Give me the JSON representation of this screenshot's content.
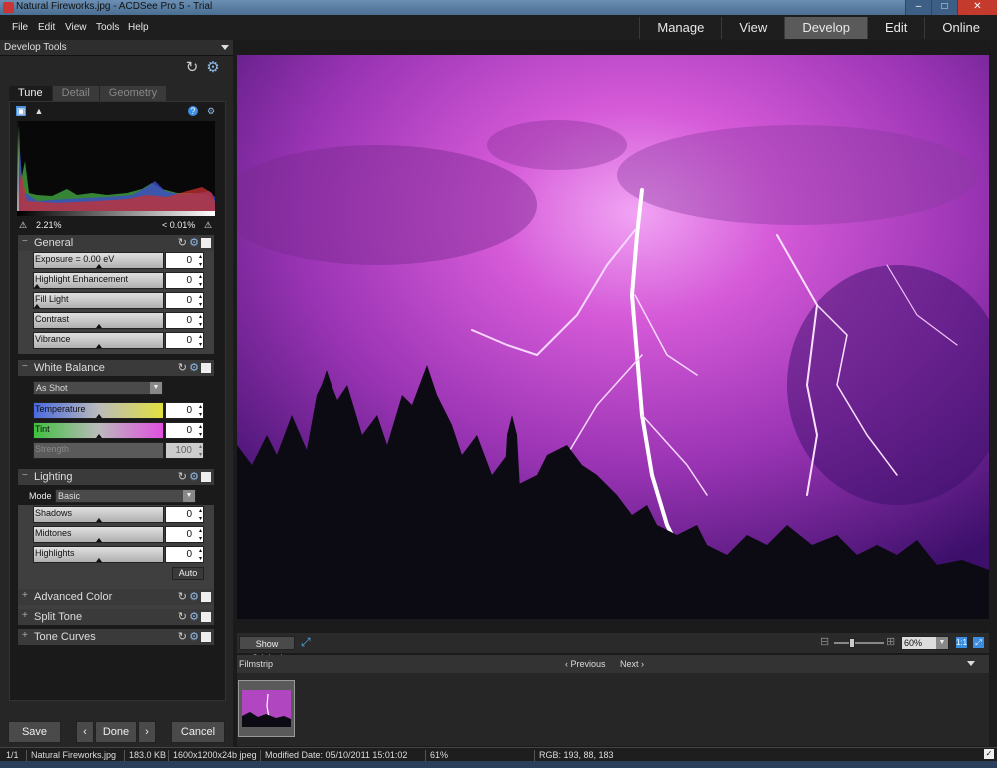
{
  "window": {
    "title": "Natural Fireworks.jpg - ACDSee Pro 5 - Trial",
    "minimize": "–",
    "maximize": "□",
    "close": "✕"
  },
  "menu": [
    "File",
    "Edit",
    "View",
    "Tools",
    "Help"
  ],
  "modes": [
    {
      "label": "Manage",
      "active": false
    },
    {
      "label": "View",
      "active": false
    },
    {
      "label": "Develop",
      "active": true
    },
    {
      "label": "Edit",
      "active": false
    },
    {
      "label": "Online",
      "active": false
    }
  ],
  "panel": {
    "title": "Develop Tools",
    "reset_icon": "refresh-icon",
    "settings_icon": "gear-icon"
  },
  "tabs": [
    {
      "label": "Tune",
      "active": true
    },
    {
      "label": "Detail",
      "active": false
    },
    {
      "label": "Geometry",
      "active": false
    }
  ],
  "histogram": {
    "shadow_clip": "2.21%",
    "highlight_clip": "< 0.01%"
  },
  "general": {
    "title": "General",
    "sliders": [
      {
        "label": "Exposure = 0.00 eV",
        "value": "0",
        "level": 0.5
      },
      {
        "label": "Highlight Enhancement",
        "value": "0",
        "level": 0.0
      },
      {
        "label": "Fill Light",
        "value": "0",
        "level": 0.0
      },
      {
        "label": "Contrast",
        "value": "0",
        "level": 0.5
      },
      {
        "label": "Vibrance",
        "value": "0",
        "level": 0.5
      }
    ]
  },
  "white_balance": {
    "title": "White Balance",
    "preset": "As Shot",
    "sliders": [
      {
        "label": "Temperature",
        "value": "0",
        "level": 0.5
      },
      {
        "label": "Tint",
        "value": "0",
        "level": 0.5
      },
      {
        "label": "Strength",
        "value": "100",
        "level": 1.0
      }
    ]
  },
  "lighting": {
    "title": "Lighting",
    "mode_label": "Mode",
    "mode_value": "Basic",
    "sliders": [
      {
        "label": "Shadows",
        "value": "0",
        "level": 0.5
      },
      {
        "label": "Midtones",
        "value": "0",
        "level": 0.5
      },
      {
        "label": "Highlights",
        "value": "0",
        "level": 0.5
      }
    ],
    "auto": "Auto"
  },
  "collapsed_sections": [
    "Advanced Color",
    "Split Tone",
    "Tone Curves"
  ],
  "buttons": {
    "save": "Save",
    "prev": "‹",
    "done": "Done",
    "next": "›",
    "cancel": "Cancel"
  },
  "viewer": {
    "show_original": "Show Original",
    "zoom": "60%",
    "zoom_level": 0.35
  },
  "filmstrip": {
    "label": "Filmstrip",
    "previous": "Previous",
    "next": "Next"
  },
  "status": {
    "index": "1/1",
    "filename": "Natural Fireworks.jpg",
    "size": "183.0 KB",
    "dims": "1600x1200x24b jpeg",
    "modified": "Modified Date: 05/10/2011 15:01:02",
    "zoom": "61%",
    "rgb": "RGB: 193, 88, 183"
  },
  "colors": {
    "accent": "#5a5a5a",
    "sky_top": "#7a2a90",
    "sky_mid": "#d55ad8",
    "sky_low": "#2b0a5a"
  }
}
